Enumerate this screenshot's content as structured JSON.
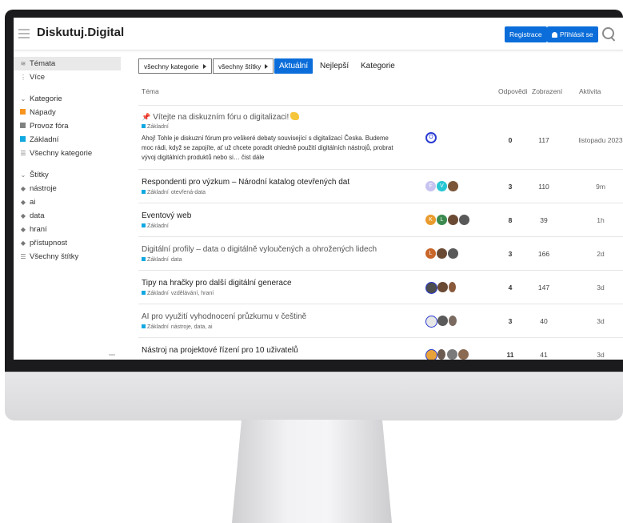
{
  "header": {
    "brand": "Diskutuj.Digital",
    "register_label": "Registrace",
    "login_label": "Přihlásit se"
  },
  "sidebar": {
    "nav": [
      {
        "label": "Témata",
        "icon": "layers-icon"
      },
      {
        "label": "Více",
        "icon": "vertical-dots-icon"
      }
    ],
    "categories_heading": "Kategorie",
    "categories": [
      {
        "label": "Nápady",
        "color": "#f7941d"
      },
      {
        "label": "Provoz fóra",
        "color": "#808281"
      },
      {
        "label": "Základní",
        "color": "#12a8e0"
      }
    ],
    "all_categories": "Všechny kategorie",
    "tags_heading": "Štítky",
    "tags": [
      "nástroje",
      "ai",
      "data",
      "hraní",
      "přístupnost"
    ],
    "all_tags": "Všechny štítky"
  },
  "filters": {
    "category_dropdown": "všechny kategorie",
    "tag_dropdown": "všechny štítky",
    "tabs": [
      "Aktuální",
      "Nejlepší",
      "Kategorie"
    ]
  },
  "table": {
    "col_topic": "Téma",
    "col_replies": "Odpovědi",
    "col_views": "Zobrazení",
    "col_activity": "Aktivita",
    "topics": [
      {
        "title": "Vítejte na diskuzním fóru o digitalizaci!",
        "category": "Základní",
        "tags": "",
        "excerpt": "Ahoj! Tohle je diskuzní fórum pro veškeré debaty související s digitalizací Česka. Budeme moc rádi, když se zapojíte, ať už chcete poradit ohledně použití digitálních nástrojů, probrat vývoj digitálních produktů nebo si… čist dále",
        "replies": "0",
        "views": "117",
        "activity": "listopadu 2023"
      },
      {
        "title": "Respondenti pro výzkum – Národní katalog otevřených dat",
        "category": "Základní",
        "tags": "otevřená-data",
        "replies": "3",
        "views": "110",
        "activity": "9m"
      },
      {
        "title": "Eventový web",
        "category": "Základní",
        "tags": "",
        "replies": "8",
        "views": "39",
        "activity": "1h"
      },
      {
        "title": "Digitální profily – data o digitálně vyloučených a ohrožených lidech",
        "category": "Základní",
        "tags": "data",
        "replies": "3",
        "views": "166",
        "activity": "2d"
      },
      {
        "title": "Tipy na hračky pro další digitální generace",
        "category": "Základní",
        "tags": "vzdělávání, hraní",
        "replies": "4",
        "views": "147",
        "activity": "3d"
      },
      {
        "title": "AI pro využití vyhodnocení průzkumu v češtině",
        "category": "Základní",
        "tags": "nástroje, data, ai",
        "replies": "3",
        "views": "40",
        "activity": "3d"
      },
      {
        "title": "Nástroj na projektové řízení pro 10 uživatelů",
        "category": "",
        "tags": "",
        "replies": "11",
        "views": "41",
        "activity": "3d"
      }
    ]
  },
  "avatars": {
    "row1": [
      "O"
    ],
    "row2": [
      "F",
      "V",
      ""
    ],
    "row3": [
      "K",
      "L",
      "",
      ""
    ],
    "row4": [
      "L",
      "",
      ""
    ],
    "row5": [
      "",
      "",
      ""
    ],
    "row6": [
      "",
      "",
      ""
    ],
    "row7": [
      "",
      "",
      "",
      ""
    ]
  },
  "colors": {
    "accent": "#0a6dd9",
    "category_zakladni": "#12a8e0"
  }
}
